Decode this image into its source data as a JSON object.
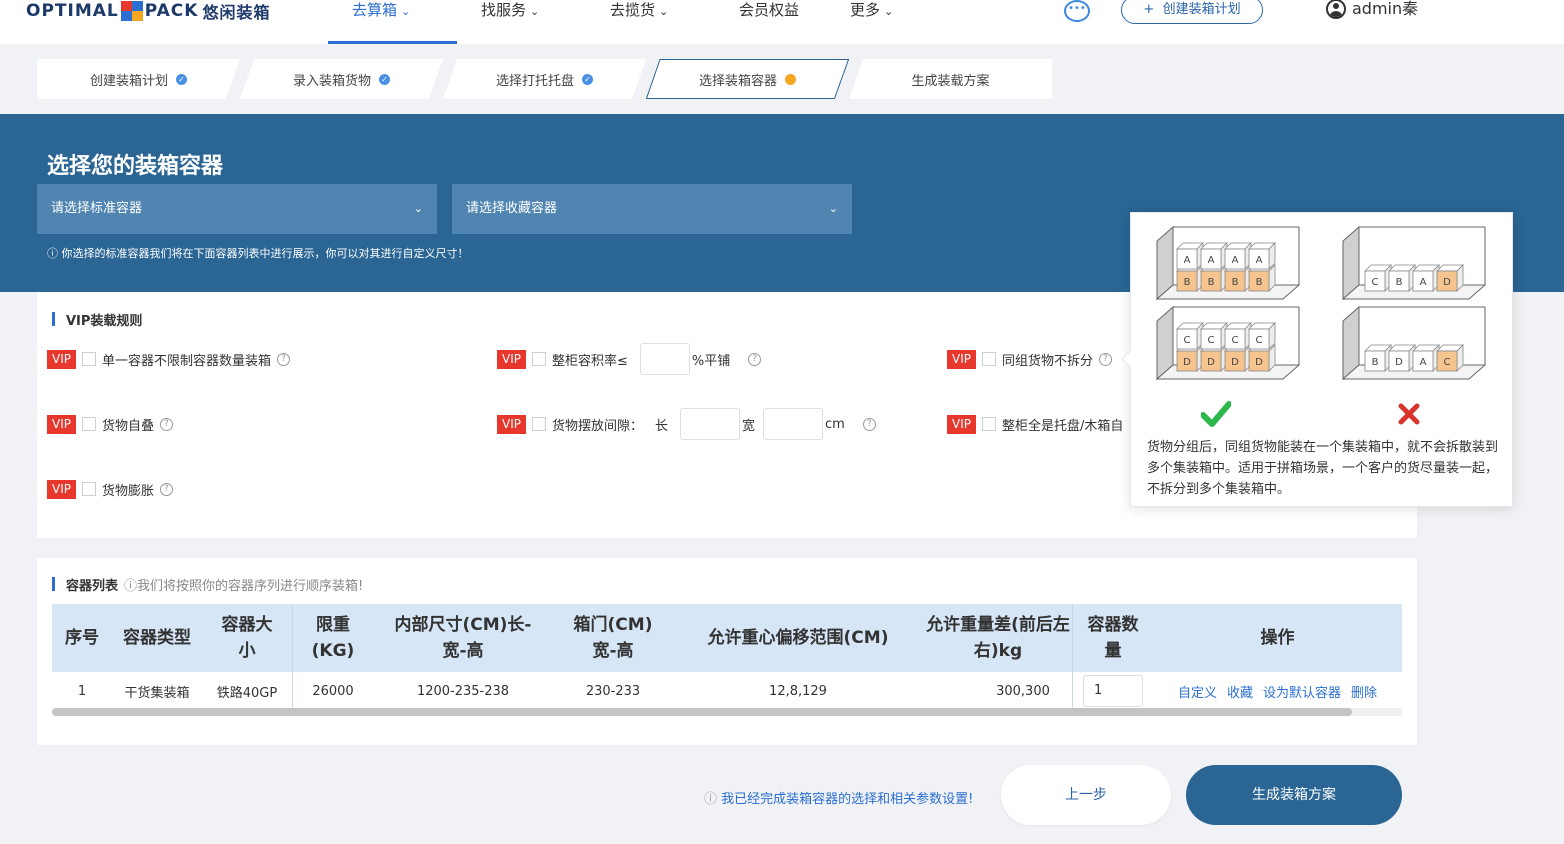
{
  "nav": {
    "logo_text_a": "OPTIMAL",
    "logo_text_b": "PACK",
    "logo_text_cn": "悠闲装箱",
    "items": [
      {
        "label": "去算箱",
        "active": true,
        "has_dropdown": true
      },
      {
        "label": "找服务",
        "has_dropdown": true
      },
      {
        "label": "去揽货",
        "has_dropdown": true
      },
      {
        "label": "会员权益",
        "has_dropdown": false
      },
      {
        "label": "更多",
        "has_dropdown": true
      }
    ],
    "create_plan": "创建装箱计划",
    "create_plan_plus": "+",
    "username": "admin秦",
    "chat_icon": "chat-bubble-icon"
  },
  "steps": [
    {
      "label": "创建装箱计划",
      "status": "done"
    },
    {
      "label": "录入装箱货物",
      "status": "done"
    },
    {
      "label": "选择打托托盘",
      "status": "done"
    },
    {
      "label": "选择装箱容器",
      "status": "current"
    },
    {
      "label": "生成装载方案",
      "status": "todo"
    }
  ],
  "banner": {
    "title": "选择您的装箱容器",
    "standard_select_placeholder": "请选择标准容器",
    "favorite_select_placeholder": "请选择收藏容器",
    "note": "你选择的标准容器我们将在下面容器列表中进行展示，你可以对其进行自定义尺寸！",
    "info_glyph": "ⓘ"
  },
  "rules": {
    "title": "VIP装载规则",
    "vip_badge": "VIP",
    "help_glyph": "?",
    "unlimited_qty": "单一容器不限制容器数量装箱",
    "fill_rate_prefix": "整柜容积率≤",
    "fill_rate_suffix": "%平铺",
    "group_no_split": "同组货物不拆分",
    "self_stack": "货物自叠",
    "gap_label": "货物摆放间隙：",
    "gap_length": "长",
    "gap_width": "宽",
    "gap_unit": "cm",
    "full_pallet": "整柜全是托盘/木箱自",
    "expand": "货物膨胀"
  },
  "container_list": {
    "title": "容器列表",
    "subtitle": "ⓘ我们将按照你的容器序列进行顺序装箱!",
    "headers": {
      "index": "序号",
      "type": "容器类型",
      "size": "容器大小",
      "weight": "限重(KG)",
      "inner": "内部尺寸(CM)长-宽-高",
      "door": "箱门(CM)宽-高",
      "cog": "允许重心偏移范围(CM)",
      "weight_diff": "允许重量差(前后左右)kg",
      "qty": "容器数量",
      "ops": "操作"
    },
    "rows": [
      {
        "index": "1",
        "type": "干货集装箱",
        "size": "铁路40GP",
        "weight": "26000",
        "inner": "1200-235-238",
        "door": "230-233",
        "cog": "12,8,129",
        "weight_diff": "300,300",
        "qty": "1",
        "ops": [
          "自定义",
          "收藏",
          "设为默认容器",
          "删除"
        ]
      }
    ]
  },
  "footer": {
    "note_icon": "ⓘ",
    "note": "我已经完成装箱容器的选择和相关参数设置!",
    "prev": "上一步",
    "generate": "生成装箱方案"
  },
  "tooltip": {
    "text": "货物分组后，同组货物能装在一个集装箱中，就不会拆散装到多个集装箱中。适用于拼箱场景，一个客户的货尽量装一起，不拆分到多个集装箱中。",
    "good_top": [
      "A",
      "A",
      "A",
      "A"
    ],
    "good_bottom": [
      "B",
      "B",
      "B",
      "B"
    ],
    "good2_top": [
      "C",
      "C",
      "C",
      "C"
    ],
    "good2_bottom": [
      "D",
      "D",
      "D",
      "D"
    ],
    "bad1": [
      "C",
      "B",
      "A",
      "D"
    ],
    "bad2": [
      "B",
      "D",
      "A",
      "C"
    ]
  },
  "colors": {
    "primary": "#2a6593",
    "accent_blue": "#2b6fd0",
    "vip_red": "#e8372c",
    "step_dot_blue": "#4a90e2",
    "step_dot_orange": "#f5a623",
    "box_orange": "#f6c58f"
  }
}
